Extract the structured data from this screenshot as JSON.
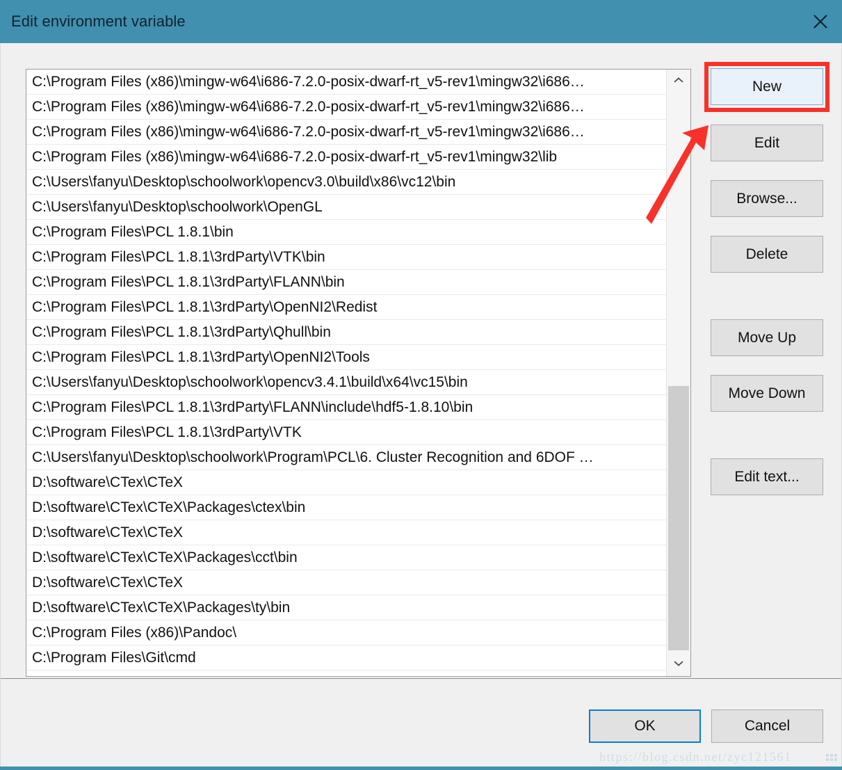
{
  "window": {
    "title": "Edit environment variable",
    "close_icon": "close-icon",
    "titlebar_color": "#4190b0"
  },
  "list": {
    "items": [
      "C:\\Program Files (x86)\\mingw-w64\\i686-7.2.0-posix-dwarf-rt_v5-rev1\\mingw32\\i686…",
      "C:\\Program Files (x86)\\mingw-w64\\i686-7.2.0-posix-dwarf-rt_v5-rev1\\mingw32\\i686…",
      "C:\\Program Files (x86)\\mingw-w64\\i686-7.2.0-posix-dwarf-rt_v5-rev1\\mingw32\\i686…",
      "C:\\Program Files (x86)\\mingw-w64\\i686-7.2.0-posix-dwarf-rt_v5-rev1\\mingw32\\lib",
      "C:\\Users\\fanyu\\Desktop\\schoolwork\\opencv3.0\\build\\x86\\vc12\\bin",
      "C:\\Users\\fanyu\\Desktop\\schoolwork\\OpenGL",
      "C:\\Program Files\\PCL 1.8.1\\bin",
      "C:\\Program Files\\PCL 1.8.1\\3rdParty\\VTK\\bin",
      "C:\\Program Files\\PCL 1.8.1\\3rdParty\\FLANN\\bin",
      "C:\\Program Files\\PCL 1.8.1\\3rdParty\\OpenNI2\\Redist",
      "C:\\Program Files\\PCL 1.8.1\\3rdParty\\Qhull\\bin",
      "C:\\Program Files\\PCL 1.8.1\\3rdParty\\OpenNI2\\Tools",
      "C:\\Users\\fanyu\\Desktop\\schoolwork\\opencv3.4.1\\build\\x64\\vc15\\bin",
      "C:\\Program Files\\PCL 1.8.1\\3rdParty\\FLANN\\include\\hdf5-1.8.10\\bin",
      "C:\\Program Files\\PCL 1.8.1\\3rdParty\\VTK",
      "C:\\Users\\fanyu\\Desktop\\schoolwork\\Program\\PCL\\6. Cluster Recognition and 6DOF …",
      "D:\\software\\CTex\\CTeX",
      "D:\\software\\CTex\\CTeX\\Packages\\ctex\\bin",
      "D:\\software\\CTex\\CTeX",
      "D:\\software\\CTex\\CTeX\\Packages\\cct\\bin",
      "D:\\software\\CTex\\CTeX",
      "D:\\software\\CTex\\CTeX\\Packages\\ty\\bin",
      "C:\\Program Files (x86)\\Pandoc\\",
      "C:\\Program Files\\Git\\cmd"
    ],
    "scrollbar": {
      "up_icon": "chevron-up-icon",
      "down_icon": "chevron-down-icon"
    }
  },
  "side_buttons": {
    "new": "New",
    "edit": "Edit",
    "browse": "Browse...",
    "delete": "Delete",
    "move_up": "Move Up",
    "move_down": "Move Down",
    "edit_text": "Edit text..."
  },
  "annotations": {
    "highlight_color": "#f8312a",
    "arrow_color": "#f8312a",
    "highlight_target": "New"
  },
  "footer": {
    "ok": "OK",
    "cancel": "Cancel",
    "watermark": "https://blog.csdn.net/zyc121561"
  }
}
